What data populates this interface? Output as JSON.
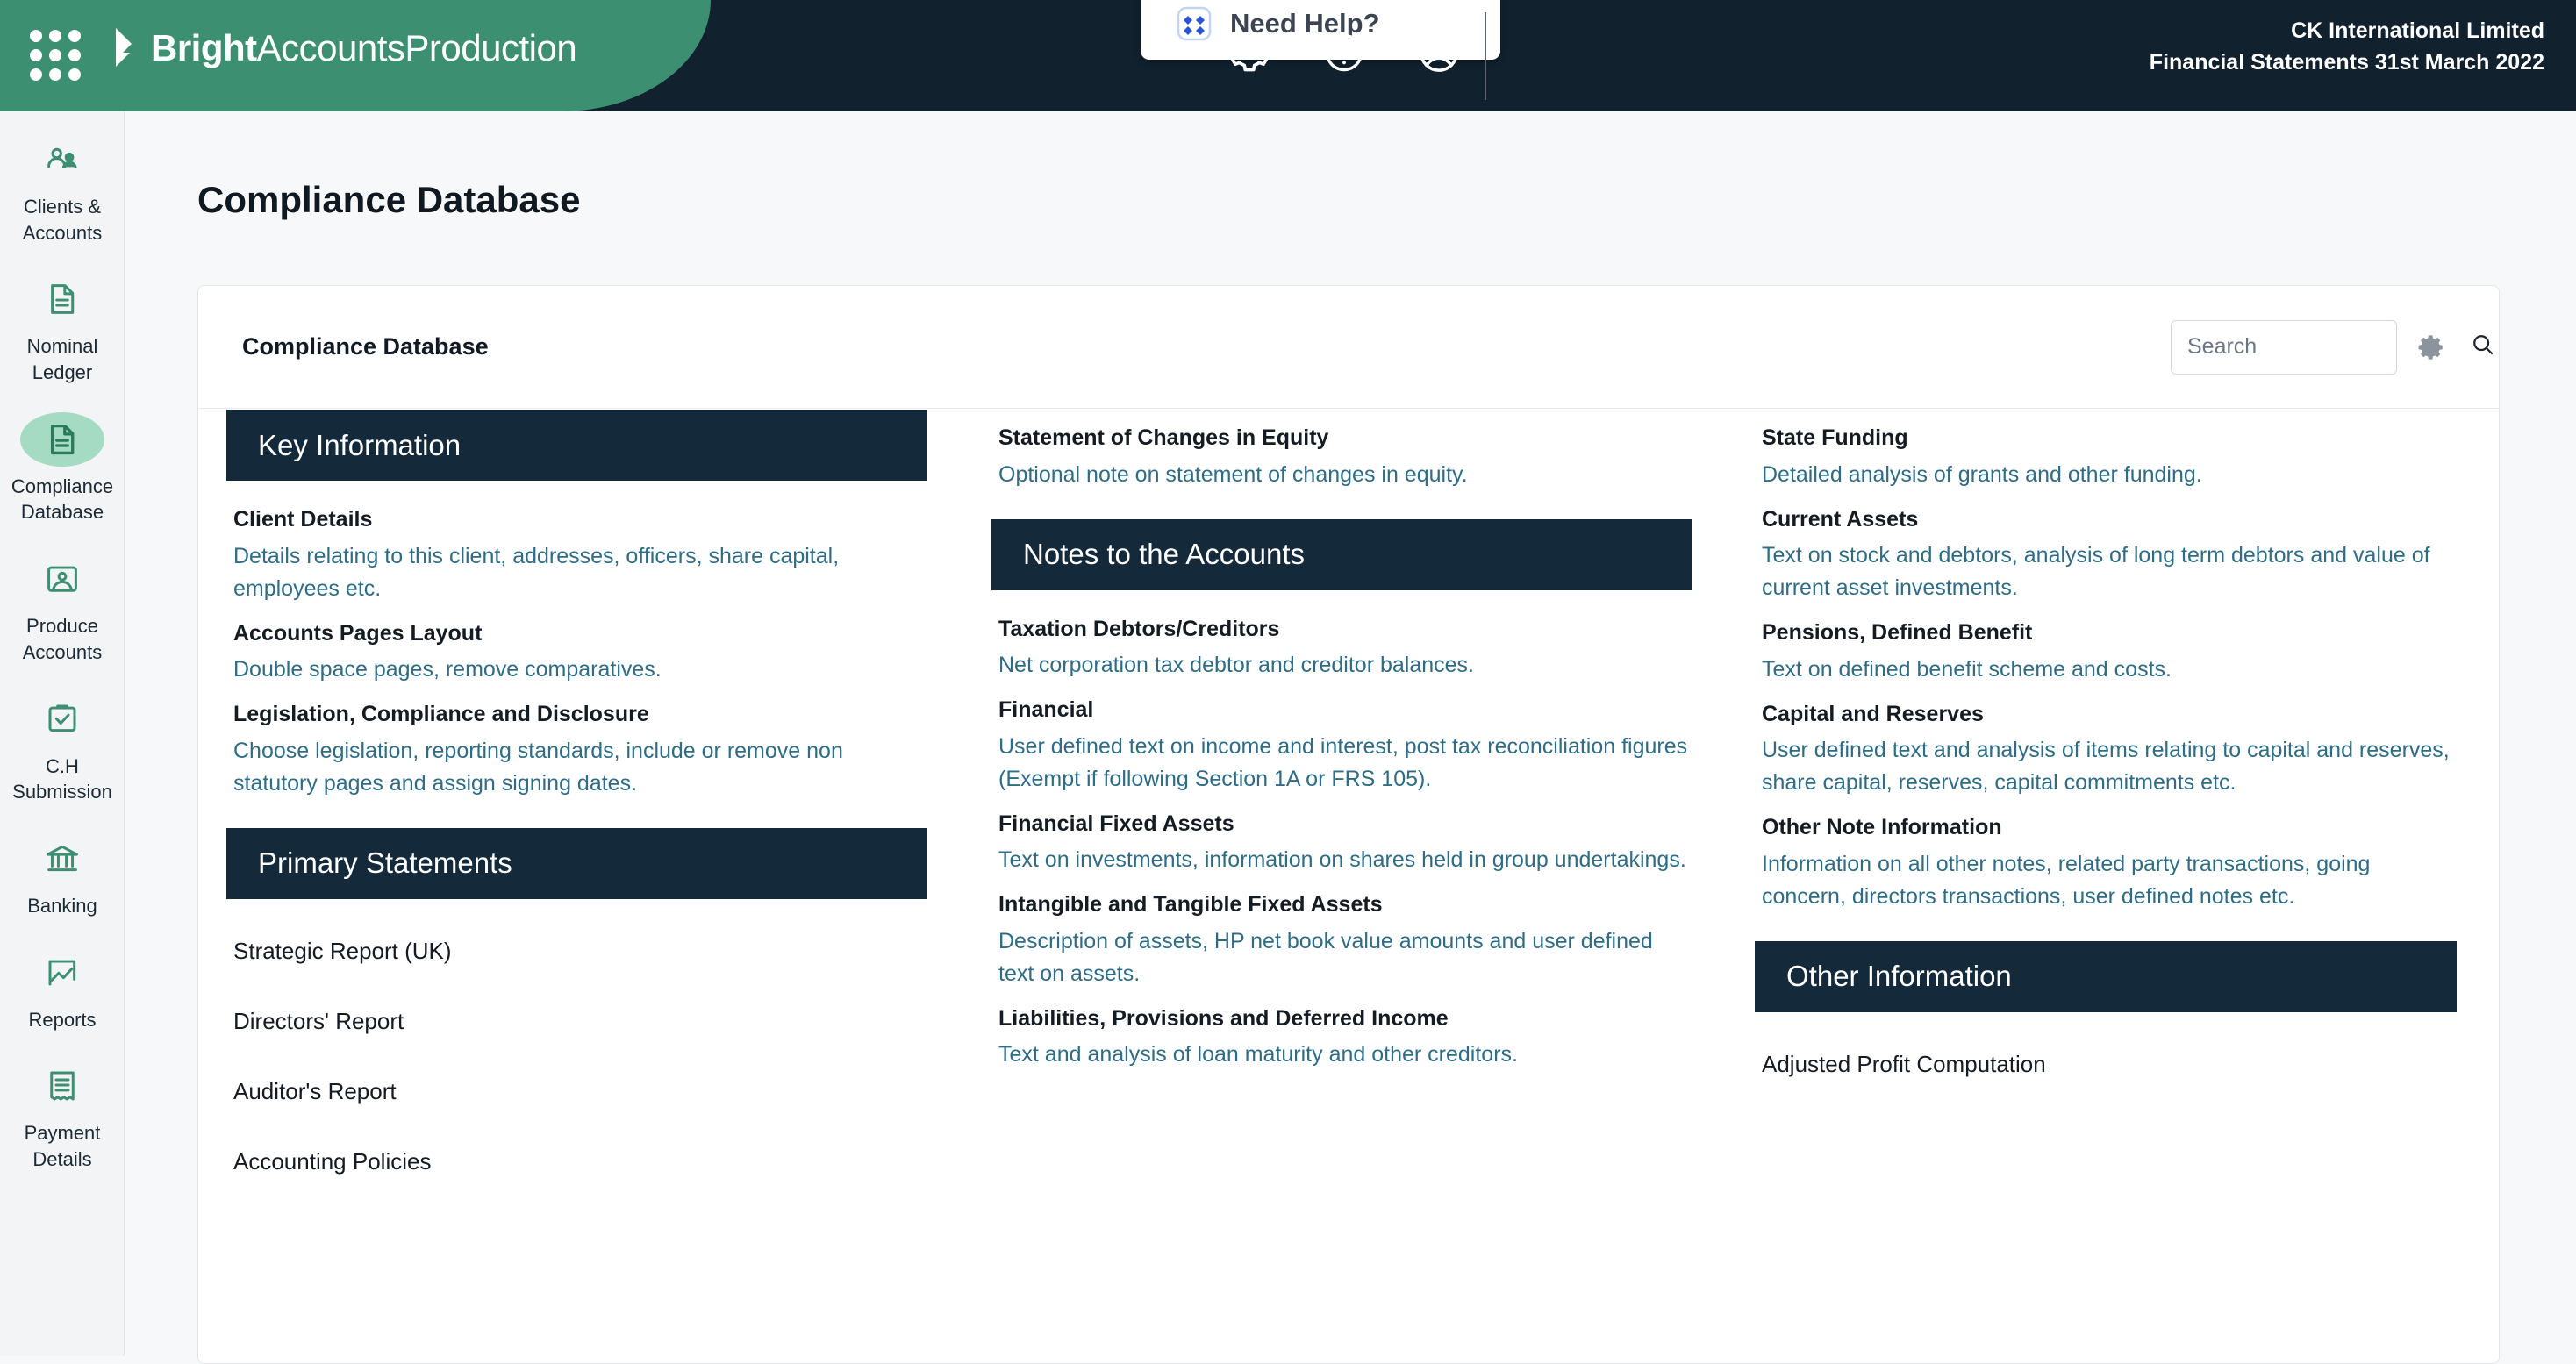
{
  "topbar": {
    "brand_bold": "Bright",
    "brand_light": "AccountsProduction",
    "help_label": "Need Help?",
    "client_name": "CK International Limited",
    "client_period": "Financial Statements 31st March 2022",
    "icons": [
      "settings-icon",
      "help-icon",
      "account-icon"
    ],
    "accent_green": "#3d8f71",
    "bar_dark": "#11212d"
  },
  "sidebar": {
    "items": [
      {
        "label": "Clients & Accounts",
        "icon": "clients-icon",
        "active": false
      },
      {
        "label": "Nominal Ledger",
        "icon": "document-icon",
        "active": false
      },
      {
        "label": "Compliance Database",
        "icon": "compliance-document-icon",
        "active": true
      },
      {
        "label": "Produce Accounts",
        "icon": "produce-accounts-icon",
        "active": false
      },
      {
        "label": "C.H Submission",
        "icon": "clipboard-check-icon",
        "active": false
      },
      {
        "label": "Banking",
        "icon": "bank-icon",
        "active": false
      },
      {
        "label": "Reports",
        "icon": "chart-icon",
        "active": false
      },
      {
        "label": "Payment Details",
        "icon": "receipt-icon",
        "active": false
      }
    ],
    "active_highlight": "#a5dbc3",
    "icon_color": "#3d8f71"
  },
  "page": {
    "title": "Compliance Database"
  },
  "card": {
    "title": "Compliance Database",
    "search": {
      "value": "",
      "placeholder": "Search"
    },
    "gear_icon": "gear-icon",
    "search_icon": "search-icon"
  },
  "columns": [
    {
      "blocks": [
        {
          "type": "section",
          "title": "Key Information",
          "entries": [
            {
              "heading": "Client Details",
              "desc": "Details relating to this client, addresses, officers, share capital, employees etc."
            },
            {
              "heading": "Accounts Pages Layout",
              "desc": "Double space pages, remove comparatives."
            },
            {
              "heading": "Legislation, Compliance and Disclosure",
              "desc": "Choose legislation, reporting standards, include or remove non statutory pages and assign signing dates."
            }
          ]
        },
        {
          "type": "section",
          "title": "Primary Statements",
          "entries": [
            {
              "heading": "Strategic Report (UK)",
              "desc": ""
            },
            {
              "heading": "Directors' Report",
              "desc": ""
            },
            {
              "heading": "Auditor's Report",
              "desc": ""
            },
            {
              "heading": "Accounting Policies",
              "desc": ""
            }
          ]
        }
      ]
    },
    {
      "blocks": [
        {
          "type": "entries",
          "entries": [
            {
              "heading": "Statement of Changes in Equity",
              "desc": "Optional note on statement of changes in equity."
            }
          ]
        },
        {
          "type": "section",
          "title": "Notes to the Accounts",
          "entries": [
            {
              "heading": "Taxation Debtors/Creditors",
              "desc": "Net corporation tax debtor and creditor balances."
            },
            {
              "heading": "Financial",
              "desc": "User defined text on income and interest, post tax reconciliation figures (Exempt if following Section 1A or FRS 105)."
            },
            {
              "heading": "Financial Fixed Assets",
              "desc": "Text on investments, information on shares held in group undertakings."
            },
            {
              "heading": "Intangible and Tangible Fixed Assets",
              "desc": "Description of assets, HP net book value amounts and user defined text on assets."
            },
            {
              "heading": "Liabilities, Provisions and Deferred Income",
              "desc": "Text and analysis of loan maturity and other creditors."
            }
          ]
        }
      ]
    },
    {
      "blocks": [
        {
          "type": "entries",
          "entries": [
            {
              "heading": "State Funding",
              "desc": "Detailed analysis of grants and other funding."
            },
            {
              "heading": "Current Assets",
              "desc": "Text on stock and debtors, analysis of long term debtors and value of current asset investments."
            },
            {
              "heading": "Pensions, Defined Benefit",
              "desc": "Text on defined benefit scheme and costs."
            },
            {
              "heading": "Capital and Reserves",
              "desc": "User defined text and analysis of items relating to capital and reserves, share capital, reserves, capital commitments etc."
            },
            {
              "heading": "Other Note Information",
              "desc": "Information on all other notes, related party transactions, going concern, directors transactions, user defined notes etc."
            }
          ]
        },
        {
          "type": "section",
          "title": "Other Information",
          "entries": [
            {
              "heading": "Adjusted Profit Computation",
              "desc": ""
            }
          ]
        }
      ]
    }
  ],
  "colors": {
    "section_bar": "#142a3b",
    "desc_text": "#2e6d85",
    "heading_text": "#141b22"
  }
}
